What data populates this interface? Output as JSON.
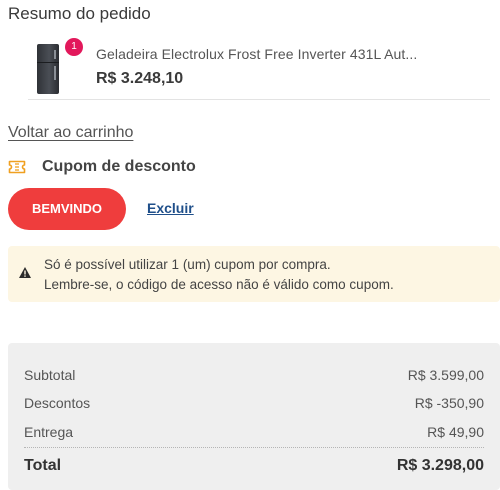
{
  "order_summary": {
    "title": "Resumo do pedido",
    "product": {
      "name": "Geladeira Electrolux Frost Free Inverter 431L Aut...",
      "price": "R$ 3.248,10",
      "quantity": "1"
    }
  },
  "back_link": "Voltar ao carrinho",
  "coupon": {
    "title": "Cupom de desconto",
    "code": "BEMVINDO",
    "remove_label": "Excluir",
    "icon": "ticket-icon",
    "accent_color": "#ef3d3d"
  },
  "alert": {
    "icon": "warning-icon",
    "line1": "Só é possível utilizar 1 (um) cupom por compra.",
    "line2": "Lembre-se, o código de acesso não é válido como cupom."
  },
  "totals": {
    "subtotal_label": "Subtotal",
    "subtotal_value": "R$ 3.599,00",
    "discount_label": "Descontos",
    "discount_value": "R$ -350,90",
    "shipping_label": "Entrega",
    "shipping_value": "R$ 49,90",
    "total_label": "Total",
    "total_value": "R$ 3.298,00"
  }
}
